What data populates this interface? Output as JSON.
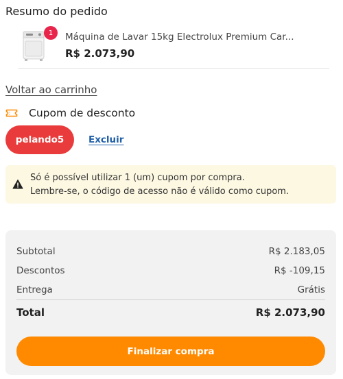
{
  "order_summary": {
    "title": "Resumo do pedido"
  },
  "product": {
    "quantity_badge": "1",
    "name": "Máquina de Lavar 15kg Electrolux Premium Car...",
    "price": "R$ 2.073,90",
    "thumbnail_icon": "washing-machine-icon"
  },
  "links": {
    "back_to_cart": "Voltar ao carrinho"
  },
  "coupon": {
    "title": "Cupom de desconto",
    "icon": "ticket-icon",
    "code": "pelando5",
    "remove_label": "Excluir"
  },
  "warning": {
    "icon": "warning-icon",
    "line1": "Só é possível utilizar 1 (um) cupom por compra.",
    "line2": "Lembre-se, o código de acesso não é válido como cupom."
  },
  "totals": {
    "subtotal_label": "Subtotal",
    "subtotal_value": "R$ 2.183,05",
    "discount_label": "Descontos",
    "discount_value": "R$ -109,15",
    "shipping_label": "Entrega",
    "shipping_value": "Grátis",
    "total_label": "Total",
    "total_value": "R$ 2.073,90"
  },
  "checkout": {
    "button_label": "Finalizar compra"
  },
  "colors": {
    "accent_orange": "#ff8a00",
    "coupon_red": "#e93b3b",
    "badge_red": "#e8254b",
    "link_blue": "#1f5fa8",
    "warning_bg": "#fdf8e2"
  }
}
